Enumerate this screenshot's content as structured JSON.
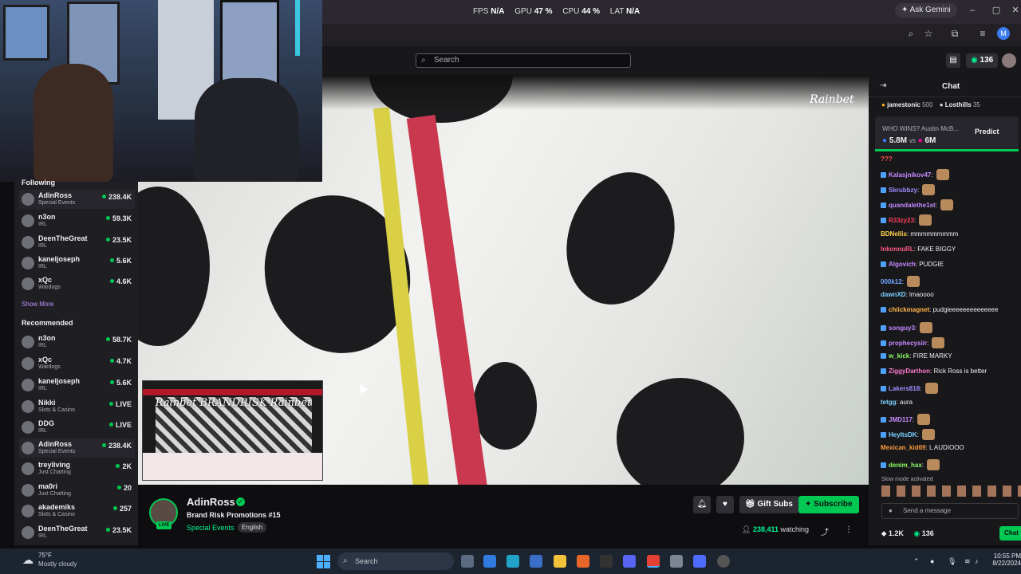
{
  "browser": {
    "perf": [
      {
        "label": "FPS",
        "value": "N/A"
      },
      {
        "label": "GPU",
        "value": "47 %"
      },
      {
        "label": "CPU",
        "value": "44 %"
      },
      {
        "label": "LAT",
        "value": "N/A"
      }
    ],
    "ask_gemini": "Ask Gemini",
    "profile_initial": "M"
  },
  "header": {
    "search_placeholder": "Search",
    "points": "136"
  },
  "sidebar": {
    "following_label": "Following",
    "following": [
      {
        "name": "AdinRoss",
        "category": "Special Events",
        "viewers": "238.4K"
      },
      {
        "name": "n3on",
        "category": "IRL",
        "viewers": "59.3K"
      },
      {
        "name": "DeenTheGreat",
        "category": "IRL",
        "viewers": "23.5K"
      },
      {
        "name": "kaneljoseph",
        "category": "IRL",
        "viewers": "5.6K"
      },
      {
        "name": "xQc",
        "category": "Wardogs",
        "viewers": "4.6K"
      }
    ],
    "show_more": "Show More",
    "recommended_label": "Recommended",
    "recommended": [
      {
        "name": "n3on",
        "category": "IRL",
        "viewers": "58.7K"
      },
      {
        "name": "xQc",
        "category": "Wardogs",
        "viewers": "4.7K"
      },
      {
        "name": "kaneljoseph",
        "category": "IRL",
        "viewers": "5.6K"
      },
      {
        "name": "Nikki",
        "category": "Slots & Casino",
        "viewers": "LIVE"
      },
      {
        "name": "DDG",
        "category": "IRL",
        "viewers": "LIVE"
      },
      {
        "name": "AdinRoss",
        "category": "Special Events",
        "viewers": "238.4K"
      },
      {
        "name": "treyliving",
        "category": "Just Chatting",
        "viewers": "2K"
      },
      {
        "name": "ma0ri",
        "category": "Just Chatting",
        "viewers": "20"
      },
      {
        "name": "akademiks",
        "category": "Slots & Casino",
        "viewers": "257"
      },
      {
        "name": "DeenTheGreat",
        "category": "IRL",
        "viewers": "23.5K"
      }
    ]
  },
  "video": {
    "watermark": "Rainbet",
    "pip_sign": "Rainbet BRANDRISK Rainbet"
  },
  "channel": {
    "name": "AdinRoss",
    "live": "LIVE",
    "title": "Brand Risk Promotions #15",
    "category": "Special Events",
    "language": "English",
    "gift_subs": "Gift Subs",
    "subscribe": "Subscribe",
    "viewers": "238,411",
    "watching_label": "watching"
  },
  "chat": {
    "title": "Chat",
    "leaderboard": [
      {
        "name": "jamestonic",
        "score": "500"
      },
      {
        "name": "Losthills",
        "score": "35"
      }
    ],
    "prediction": {
      "question": "WHO WINS? Austin McB...",
      "left": "5.8M",
      "vs": "vs",
      "right": "6M",
      "button": "Predict"
    },
    "messages": [
      {
        "user": "???",
        "text": "",
        "color": "#ff4f4f"
      },
      {
        "user": "Kalasjnikov47",
        "text": "",
        "color": "#c58aff"
      },
      {
        "user": "Skrubbzy",
        "text": "",
        "color": "#9f8cff"
      },
      {
        "user": "quandalethe1st",
        "text": "",
        "color": "#c58aff"
      },
      {
        "user": "R33zy23",
        "text": "",
        "color": "#ff3b5c"
      },
      {
        "user": "BDNellis",
        "text": "mmmmmmmmm",
        "color": "#ffd24a"
      },
      {
        "user": "InkonnuRL",
        "text": "FAKE BIGGY",
        "color": "#ff5b86"
      },
      {
        "user": "Algovich",
        "text": "PUDGIE",
        "color": "#c58aff"
      },
      {
        "user": "000k12",
        "text": "",
        "color": "#6fa8ff"
      },
      {
        "user": "dawnXD",
        "text": "lmaoooo",
        "color": "#7ad1ff"
      },
      {
        "user": "chiickmagnet",
        "text": "pudgieeeeeeeeeeeeee",
        "color": "#ffb347"
      },
      {
        "user": "songuy3",
        "text": "",
        "color": "#c58aff"
      },
      {
        "user": "prophecysiir",
        "text": "",
        "color": "#c58aff"
      },
      {
        "user": "w_kick",
        "text": "FIRE MARKY",
        "color": "#8cff66"
      },
      {
        "user": "ZiggyDarthon",
        "text": "Rick Ross is better",
        "color": "#ff7ad1"
      },
      {
        "user": "Lakers818",
        "text": "",
        "color": "#9f8cff"
      },
      {
        "user": "tetgg",
        "text": "aura",
        "color": "#7ad1ff"
      },
      {
        "user": "JMD117",
        "text": "",
        "color": "#c58aff"
      },
      {
        "user": "HeyItsDK",
        "text": "",
        "color": "#7ad1ff"
      },
      {
        "user": "Mexican_kid69",
        "text": "L AUDIOOO",
        "color": "#ff9a3c"
      },
      {
        "user": "denim_hax",
        "text": "",
        "color": "#8cff66"
      }
    ],
    "slow_mode": "Slow mode activated",
    "input_placeholder": "Send a message",
    "footer_left": "1.2K",
    "footer_points": "136",
    "send": "Chat"
  },
  "taskbar": {
    "temp": "75°F",
    "condition": "Mostly cloudy",
    "search": "Search",
    "time": "10:55 PM",
    "date": "8/22/2024"
  }
}
